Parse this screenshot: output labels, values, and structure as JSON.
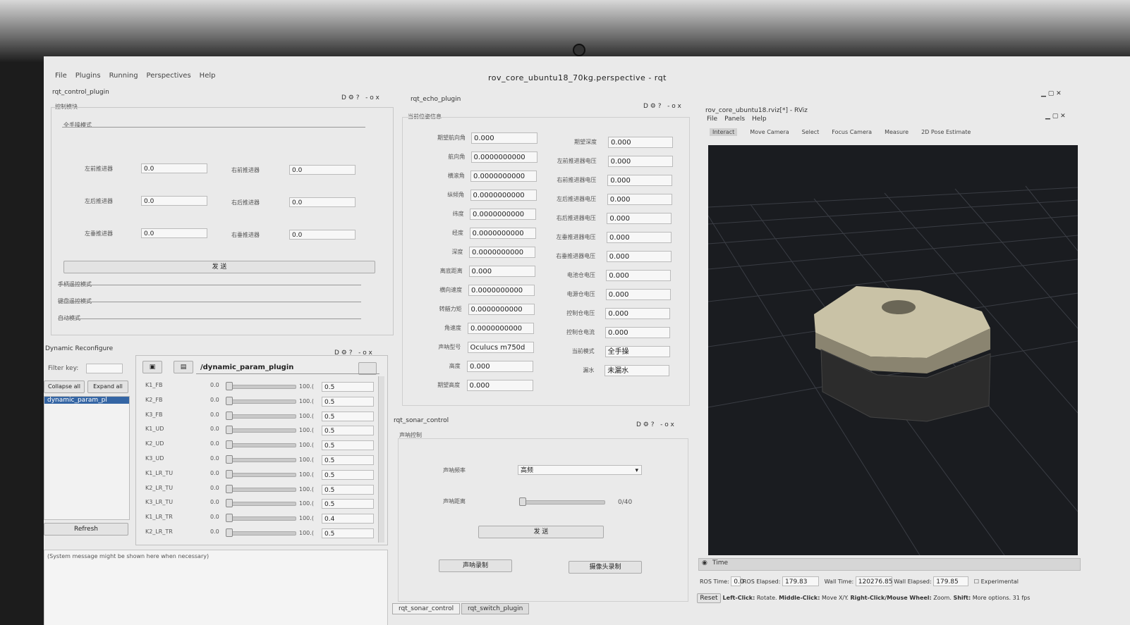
{
  "window": {
    "title": "rov_core_ubuntu18_70kg.perspective - rqt",
    "menu": [
      "File",
      "Plugins",
      "Running",
      "Perspectives",
      "Help"
    ]
  },
  "control_plugin": {
    "title": "rqt_control_plugin",
    "section": "控制模块",
    "mode_full": "全手操模式",
    "thrusters": [
      {
        "left_label": "左前推进器",
        "left_value": "0.0",
        "right_label": "右前推进器",
        "right_value": "0.0"
      },
      {
        "left_label": "左后推进器",
        "left_value": "0.0",
        "right_label": "右后推进器",
        "right_value": "0.0"
      },
      {
        "left_label": "左垂推进器",
        "left_value": "0.0",
        "right_label": "右垂推进器",
        "right_value": "0.0"
      }
    ],
    "send_label": "发 送",
    "mode_handle": "手柄遥控模式",
    "mode_keyboard": "键盘遥控模式",
    "mode_auto": "自动模式"
  },
  "dynamic_reconfigure": {
    "title": "Dynamic Reconfigure",
    "filter_label": "Filter key:",
    "filter_value": "",
    "collapse_label": "Collapse all",
    "expand_label": "Expand all",
    "selected_node": "dynamic_param_pl",
    "refresh_label": "Refresh",
    "node_title": "/dynamic_param_plugin",
    "params": [
      {
        "name": "K1_FB",
        "min": "0.0",
        "max": "100.(",
        "value": "0.5",
        "level": 0.005
      },
      {
        "name": "K2_FB",
        "min": "0.0",
        "max": "100.(",
        "value": "0.5",
        "level": 0.005
      },
      {
        "name": "K3_FB",
        "min": "0.0",
        "max": "100.(",
        "value": "0.5",
        "level": 0.005
      },
      {
        "name": "K1_UD",
        "min": "0.0",
        "max": "100.(",
        "value": "0.5",
        "level": 0.005
      },
      {
        "name": "K2_UD",
        "min": "0.0",
        "max": "100.(",
        "value": "0.5",
        "level": 0.005
      },
      {
        "name": "K3_UD",
        "min": "0.0",
        "max": "100.(",
        "value": "0.5",
        "level": 0.005
      },
      {
        "name": "K1_LR_TU",
        "min": "0.0",
        "max": "100.(",
        "value": "0.5",
        "level": 0.005
      },
      {
        "name": "K2_LR_TU",
        "min": "0.0",
        "max": "100.(",
        "value": "0.5",
        "level": 0.005
      },
      {
        "name": "K3_LR_TU",
        "min": "0.0",
        "max": "100.(",
        "value": "0.5",
        "level": 0.005
      },
      {
        "name": "K1_LR_TR",
        "min": "0.0",
        "max": "100.(",
        "value": "0.4",
        "level": 0.004
      },
      {
        "name": "K2_LR_TR",
        "min": "0.0",
        "max": "100.(",
        "value": "0.5",
        "level": 0.005
      }
    ],
    "system_message": "(System message might be shown here when necessary)"
  },
  "echo_plugin": {
    "title": "rqt_echo_plugin",
    "section": "当前位姿信息",
    "left": [
      {
        "label": "期望航向角",
        "value": "0.000"
      },
      {
        "label": "航向角",
        "value": "0.0000000000"
      },
      {
        "label": "横滚角",
        "value": "0.0000000000"
      },
      {
        "label": "纵倾角",
        "value": "0.0000000000"
      },
      {
        "label": "纬度",
        "value": "0.0000000000"
      },
      {
        "label": "经度",
        "value": "0.0000000000"
      },
      {
        "label": "深度",
        "value": "0.0000000000"
      },
      {
        "label": "离底距离",
        "value": "0.000"
      },
      {
        "label": "横向速度",
        "value": "0.0000000000"
      },
      {
        "label": "转艏力矩",
        "value": "0.0000000000"
      },
      {
        "label": "角速度",
        "value": "0.0000000000"
      },
      {
        "label": "声呐型号",
        "value": "Oculucs m750d"
      },
      {
        "label": "高度",
        "value": "0.000"
      },
      {
        "label": "期望高度",
        "value": "0.000"
      }
    ],
    "right": [
      {
        "label": "期望深度",
        "value": "0.000"
      },
      {
        "label": "左前推进器电压",
        "value": "0.000"
      },
      {
        "label": "右前推进器电压",
        "value": "0.000"
      },
      {
        "label": "左后推进器电压",
        "value": "0.000"
      },
      {
        "label": "右后推进器电压",
        "value": "0.000"
      },
      {
        "label": "左垂推进器电压",
        "value": "0.000"
      },
      {
        "label": "右垂推进器电压",
        "value": "0.000"
      },
      {
        "label": "电池仓电压",
        "value": "0.000"
      },
      {
        "label": "电源仓电压",
        "value": "0.000"
      },
      {
        "label": "控制仓电压",
        "value": "0.000"
      },
      {
        "label": "控制仓电流",
        "value": "0.000"
      },
      {
        "label": "当前模式",
        "value": "全手操"
      },
      {
        "label": "漏水",
        "value": "未漏水"
      }
    ]
  },
  "sonar_control": {
    "title": "rqt_sonar_control",
    "section": "声呐控制",
    "freq_label": "声呐频率",
    "freq_value": "高频",
    "range_label": "声呐距离",
    "range_value": "0/40",
    "range_level": 0,
    "send_label": "发 送",
    "record_sonar": "声呐录制",
    "record_camera": "摄像头录制",
    "tabs": [
      "rqt_sonar_control",
      "rqt_switch_plugin"
    ]
  },
  "rviz": {
    "title": "rov_core_ubuntu18.rviz[*] - RViz",
    "menu": [
      "File",
      "Panels",
      "Help"
    ],
    "tools": [
      "Interact",
      "Move Camera",
      "Select",
      "Focus Camera",
      "Measure",
      "2D Pose Estimate"
    ],
    "time_panel": "Time",
    "ros_time_label": "ROS Time:",
    "ros_time_value": "0.0",
    "ros_elapsed_label": "ROS Elapsed:",
    "ros_elapsed_value": "179.83",
    "wall_time_label": "Wall Time:",
    "wall_time_value": "120276.85",
    "wall_elapsed_label": "Wall Elapsed:",
    "wall_elapsed_value": "179.85",
    "experimental_label": "Experimental",
    "reset_label": "Reset",
    "status_hint_left": "Left-Click:",
    "status_hint_left_text": "Rotate.",
    "status_hint_middle": "Middle-Click:",
    "status_hint_middle_text": "Move X/Y.",
    "status_hint_right": "Right-Click/Mouse Wheel:",
    "status_hint_right_text": "Zoom.",
    "status_hint_shift": "Shift:",
    "status_hint_shift_text": "More options.",
    "fps": "31 fps"
  }
}
